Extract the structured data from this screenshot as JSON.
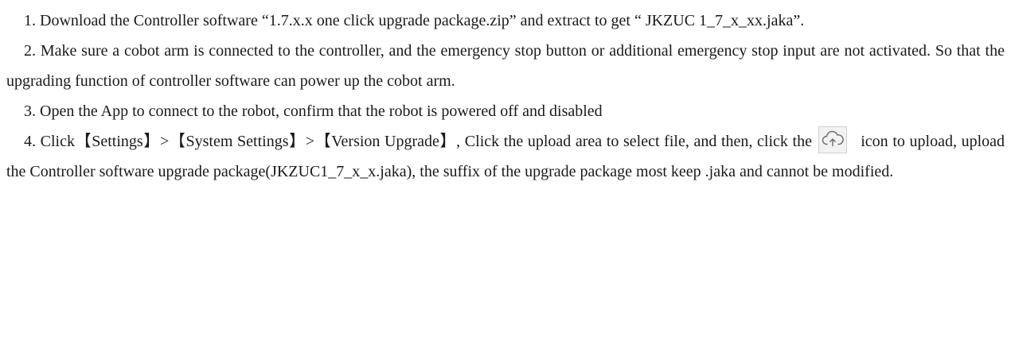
{
  "steps": [
    {
      "number": "1.",
      "text": "Download the Controller software “1.7.x.x one click upgrade package.zip” and extract to get “ JKZUC 1_7_x_xx.jaka”."
    },
    {
      "number": "2.",
      "text": "Make sure a cobot arm is connected to the controller, and the emergency stop button or additional emergency stop input are not activated. So that the upgrading function of controller software can power up the cobot arm."
    },
    {
      "number": "3.",
      "text": "Open the App to connect to the robot, confirm that the robot is powered off and disabled"
    },
    {
      "number": "4.",
      "text_before_icon": "Click【Settings】>【System Settings】>【Version Upgrade】, Click the upload area to select file, and then, click the",
      "text_after_icon": "icon to upload, upload the Controller software upgrade package(JKZUC1_7_x_x.jaka), the suffix of the upgrade package most keep .jaka and cannot be modified.",
      "icon": "upload-cloud-icon"
    }
  ],
  "colors": {
    "text": "#1a1a1a",
    "icon_border": "#d0d0d0",
    "icon_fill": "#f2f2f2",
    "icon_stroke": "#6b6b6b"
  }
}
